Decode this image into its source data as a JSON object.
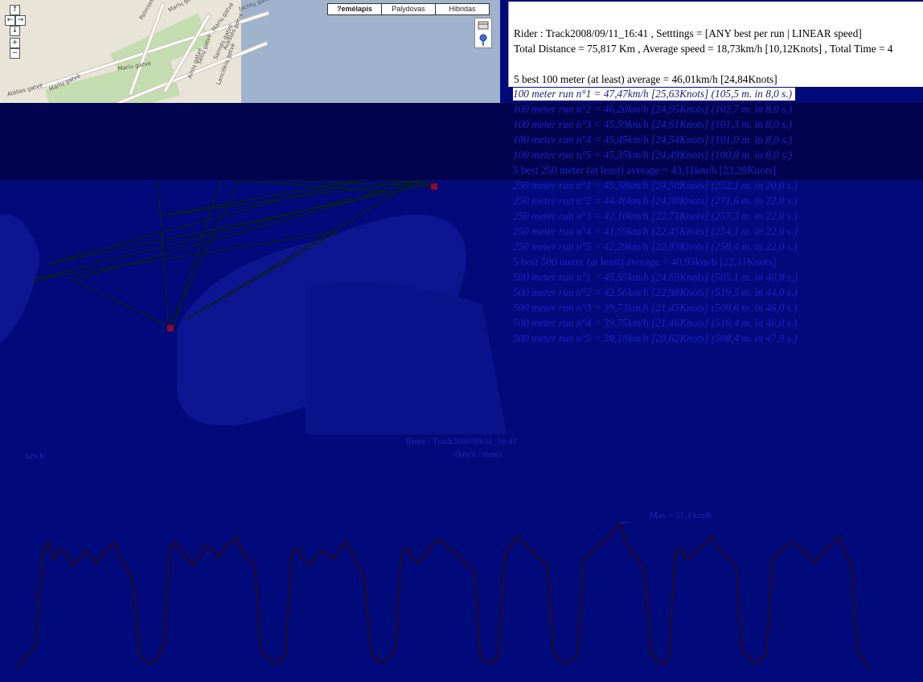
{
  "map": {
    "nav_up": "↑",
    "nav_left": "←",
    "nav_right": "→",
    "nav_down": "↓",
    "zoom_in": "+",
    "zoom_out": "−",
    "map_types": [
      "?emėlapis",
      "Palydovas",
      "Hibridas"
    ],
    "selected_map_type": "?emėlapis",
    "street_labels": [
      "Palmiono",
      "Ainių gatvė",
      "Sėlių gatvė",
      "Salmės gatvė",
      "Aukštės gatvė",
      "Marių gatvė",
      "Mariu gatve",
      "Lanciškių gatvė",
      "Jachtų gatvė",
      "Atėlies gatvė",
      "Marių gatvė",
      "Marių gatvė"
    ],
    "colors": {
      "water": "#9fb3cd",
      "land": "#e8e4d8",
      "park": "#c4ddb0",
      "overlay": "#000a7a"
    }
  },
  "stats": {
    "rider_line": "Rider : Track2008/09/11_16:41 , Setttings = [ANY best per run | LINEAR speed]",
    "total_line": "Total Distance = 75,817 Km , Average speed = 18,73km/h [10,12Knots] , Total Time = 4",
    "best100_header": "5 best 100 meter (at least) average = 46,01km/h [24,84Knots]",
    "runs100": [
      "100 meter run n°1 = 47,47km/h [25,63Knots] (105,5 m. in 8,0 s.)",
      "100 meter run n°2 = 46,20km/h [24,95Knots] (102,7 m. in 8,0 s.)",
      "100 meter run n°3 = 45,59km/h [24,61Knots] (101,3 m. in 8,0 s.)",
      "100 meter run n°4 = 45,45km/h [24,54Knots] (101,0 m. in 8,0 s.)",
      "100 meter run n°5 = 45,35km/h [24,49Knots] (100,8 m. in 8,0 s.)"
    ],
    "best250_header": "5 best 250 meter (at least) average = 43,11km/h [23,28Knots]",
    "runs250": [
      "250 meter run n°1 = 45,38km/h [24,50Knots] (252,1 m. in 20,0 s.)",
      "250 meter run n°2 = 44,46km/h [24,00Knots] (271,6 m. in 22,0 s.)",
      "250 meter run n°3 = 42,10km/h [22,73Knots] (257,3 m. in 22,0 s.)",
      "250 meter run n°4 = 41,59km/h [22,45Knots] (254,1 m. in 22,0 s.)",
      "250 meter run n°5 = 42,29km/h [22,83Knots] (258,4 m. in 22,0 s.)"
    ],
    "best500_header": "5 best 500 meter (at least) average = 40,95km/h [22,11Knots]",
    "runs500": [
      "500 meter run n°1 = 45,55km/h [24,59Knots] (505,1 m. in 40,0 s.)",
      "500 meter run n°2 = 42,56km/h [22,98Knots] (519,5 m. in 44,0 s.)",
      "500 meter run n°3 = 39,73km/h [21,45Knots] (508,6 m. in 46,0 s.)",
      "500 meter run n°4 = 39,75km/h [21,46Knots] (516,4 m. in 46,0 s.)",
      "500 meter run n°5 = 38,18km/h [20,62Knots] (508,4 m. in 47,9 s.)"
    ]
  },
  "chart": {
    "title": "Rider : Track2008/09/11_16:41",
    "subtitle": "(km/h / time)",
    "left_label": "km/h",
    "max_label": "Max = 51,3 km/h",
    "colors": {
      "line": "#2a0a1c",
      "bg": "#000a7a"
    }
  },
  "chart_data": {
    "type": "line",
    "title": "Rider : Track2008/09/11_16:41",
    "subtitle": "(km/h / time)",
    "annotation": "Max = 51,3 km/h",
    "series": [
      {
        "values": [
          0,
          4,
          6,
          8,
          40,
          44,
          38,
          42,
          40,
          36,
          38,
          41,
          39,
          37,
          40,
          42,
          44,
          38,
          35,
          30,
          5,
          3,
          2,
          4,
          8,
          42,
          44,
          40,
          38,
          36,
          40,
          43,
          41,
          39,
          42,
          44,
          46,
          40,
          38,
          36,
          6,
          4,
          2,
          3,
          5,
          40,
          42,
          38,
          36,
          39,
          41,
          40,
          38,
          42,
          44,
          40,
          36,
          30,
          6,
          3,
          2,
          4,
          6,
          40,
          42,
          38,
          37,
          40,
          43,
          45,
          44,
          42,
          40,
          38,
          36,
          34,
          4,
          3,
          2,
          5,
          40,
          43,
          46,
          44,
          42,
          40,
          38,
          36,
          6,
          3,
          2,
          3,
          5,
          38,
          40,
          42,
          44,
          46,
          48,
          51,
          44,
          40,
          38,
          34,
          6,
          3,
          2,
          4,
          40,
          42,
          38,
          40,
          42,
          44,
          46,
          42,
          40,
          38,
          36,
          6,
          4,
          2,
          3,
          5,
          38,
          40,
          42,
          44,
          43,
          41,
          39,
          37,
          40,
          42,
          44,
          46,
          40,
          36,
          6,
          3,
          0
        ]
      }
    ],
    "max_value": 51.3,
    "ylim": [
      0,
      55
    ],
    "grid": false
  }
}
